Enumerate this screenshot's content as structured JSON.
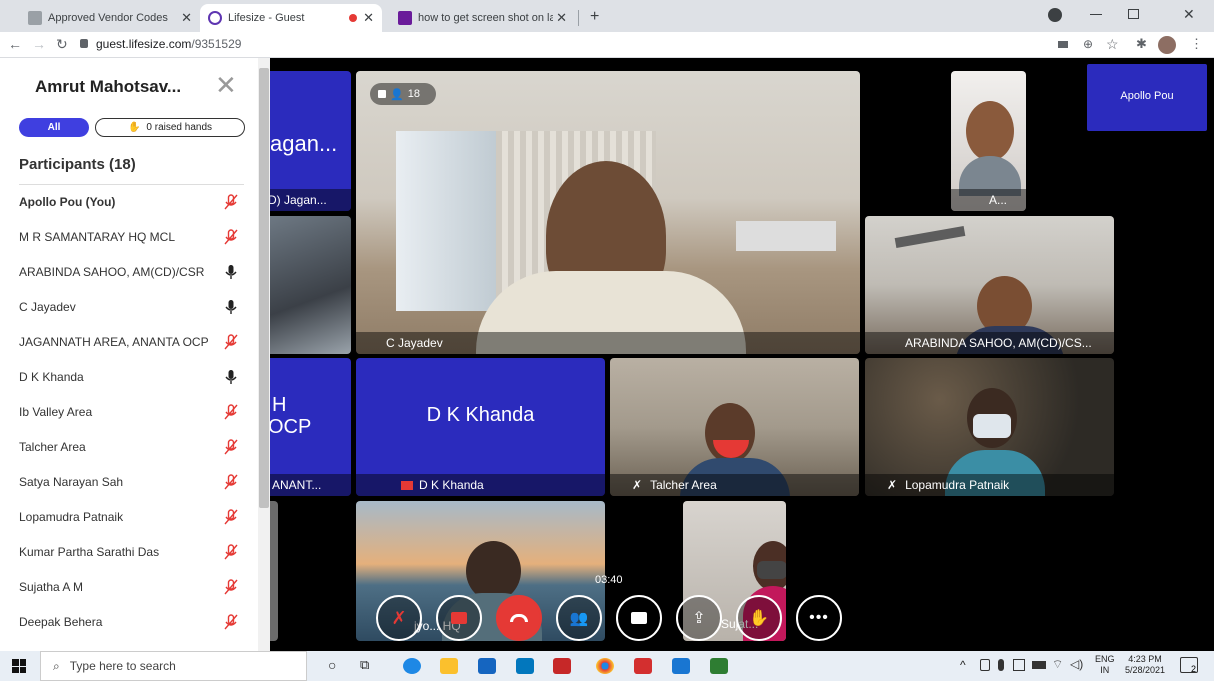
{
  "browser": {
    "tabs": [
      {
        "title": "Approved Vendor Codes",
        "close": "✕"
      },
      {
        "title": "Lifesize - Guest",
        "close": "✕"
      },
      {
        "title": "how to get screen shot on laptop",
        "close": "✕"
      }
    ],
    "new_tab": "+",
    "url_host": "guest.lifesize.com",
    "url_path": "/9351529"
  },
  "panel": {
    "title": "Amrut Mahotsav...",
    "filter_all": "All",
    "raised_hands": "0 raised hands",
    "participants_heading": "Participants (18)",
    "participants": [
      {
        "name": "Apollo Pou (You)",
        "muted": true,
        "bold": true
      },
      {
        "name": "M R SAMANTARAY HQ MCL",
        "muted": true
      },
      {
        "name": "ARABINDA SAHOO, AM(CD)/CSR",
        "muted": false
      },
      {
        "name": "C Jayadev",
        "muted": false
      },
      {
        "name": "JAGANNATH AREA, ANANTA OCP",
        "muted": true
      },
      {
        "name": "D K Khanda",
        "muted": false
      },
      {
        "name": "Ib Valley Area",
        "muted": true
      },
      {
        "name": "Talcher Area",
        "muted": true
      },
      {
        "name": "Satya Narayan Sah",
        "muted": true
      },
      {
        "name": "Lopamudra Patnaik",
        "muted": true
      },
      {
        "name": "Kumar Partha Sarathi Das",
        "muted": true
      },
      {
        "name": "Sujatha A M",
        "muted": true
      },
      {
        "name": "Deepak Behera",
        "muted": true
      }
    ]
  },
  "video": {
    "participant_count": "18",
    "self_view": "Apollo Pou",
    "tiles": {
      "jagan_big": "agan...",
      "jagan_label": "D) Jagan...",
      "jayadev": "C Jayadev",
      "arabinda": "ARABINDA SAHOO, AM(CD)/CS...",
      "small_top": "A...",
      "ananta_big_1": "H",
      "ananta_big_2": "OCP",
      "ananta_label": ", ANANT...",
      "dk_big": "D K Khanda",
      "dk_label": "D K Khanda",
      "talcher": "Talcher Area",
      "lopamudra": "Lopamudra Patnaik",
      "bottom_a": "jyo... HQ",
      "bottom_b": "Sujat..."
    },
    "timer": "03:40"
  },
  "taskbar": {
    "search_placeholder": "Type here to search",
    "lang_1": "ENG",
    "lang_2": "IN",
    "time": "4:23 PM",
    "date": "5/28/2021",
    "notifications": "2"
  },
  "colors": {
    "accent_blue": "#2b2bbd",
    "mute_red": "#e53935",
    "end_call_red": "#e53935"
  }
}
